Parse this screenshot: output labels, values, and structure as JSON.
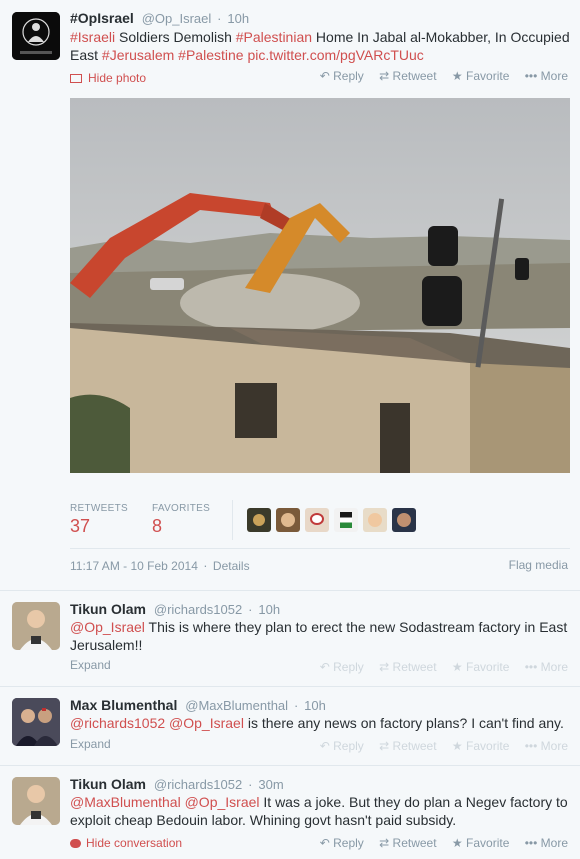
{
  "focus": {
    "fullname": "#OpIsrael",
    "screen_name": "@Op_Israel",
    "time": "10h",
    "text_parts": {
      "h1": "#Israeli",
      "t1": " Soldiers Demolish ",
      "h2": "#Palestinian",
      "t2": " Home In Jabal al-Mokabber, In Occupied East ",
      "h3": "#Jerusalem",
      "t3": " ",
      "h4": "#Palestine",
      "t4": " ",
      "link": "pic.twitter.com/pgVARcTUuc"
    },
    "hide_photo": "Hide photo",
    "retweets_label": "RETWEETS",
    "retweets": "37",
    "favorites_label": "FAVORITES",
    "favorites": "8",
    "timestamp": "11:17 AM - 10 Feb 2014",
    "details": "Details",
    "flag_media": "Flag media",
    "avatar_caption": "Operation Israel"
  },
  "actions": {
    "reply": "Reply",
    "retweet": "Retweet",
    "favorite": "Favorite",
    "more": "More"
  },
  "replies": [
    {
      "fullname": "Tikun Olam",
      "screen_name": "@richards1052",
      "time": "10h",
      "mention1": "@Op_Israel",
      "text": " This is where they plan to erect the new Sodastream factory in East Jerusalem!!",
      "expand": "Expand"
    },
    {
      "fullname": "Max Blumenthal",
      "screen_name": "@MaxBlumenthal",
      "time": "10h",
      "mention1": "@richards1052",
      "mention2": "@Op_Israel",
      "text": " is there any news on factory plans? I can't find any.",
      "expand": "Expand"
    },
    {
      "fullname": "Tikun Olam",
      "screen_name": "@richards1052",
      "time": "30m",
      "mention1": "@MaxBlumenthal",
      "mention2": "@Op_Israel",
      "text": " It was a joke. But they do plan a Negev factory to exploit cheap Bedouin labor. Whining govt hasn't paid subsidy.",
      "hide": "Hide conversation"
    }
  ],
  "colors": {
    "accent": "#d04f4f",
    "muted": "#8899a6",
    "text": "#292f33",
    "bg": "#f5f8fa"
  }
}
